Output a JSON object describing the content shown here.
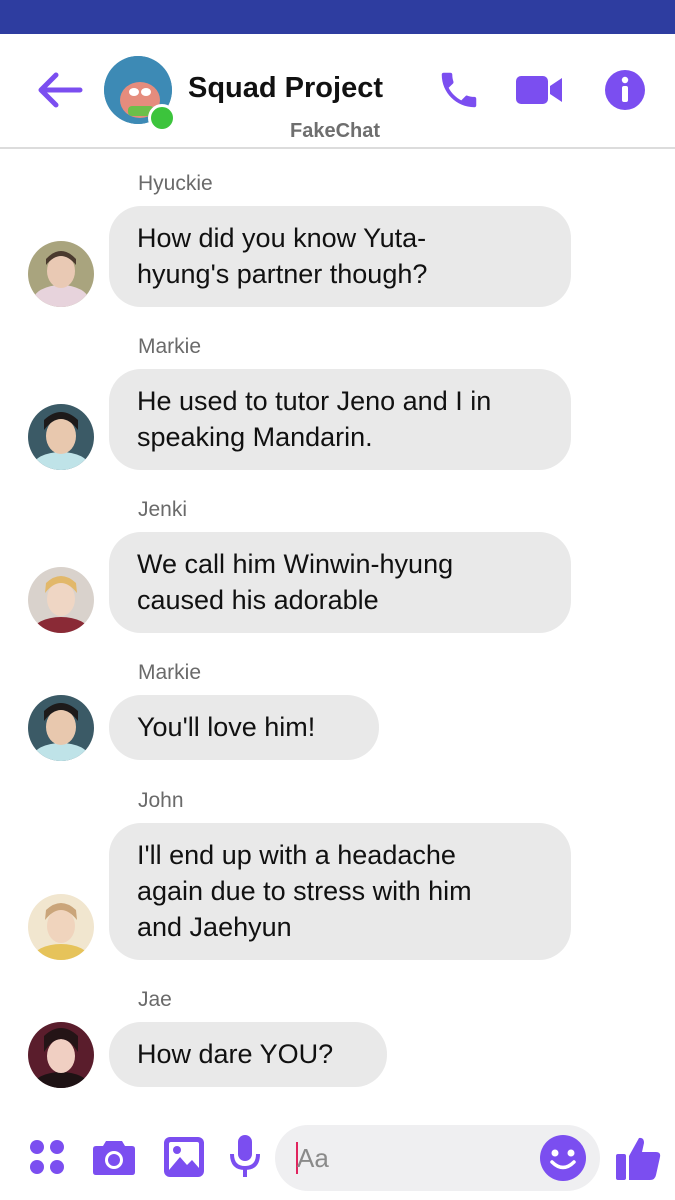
{
  "header": {
    "title": "Squad Project",
    "subtitle": "FakeChat",
    "accent_color": "#7b4ef0",
    "status_bar_color": "#2e3da0",
    "icons": [
      "back-arrow-icon",
      "phone-icon",
      "video-camera-icon",
      "info-icon"
    ]
  },
  "messages": [
    {
      "sender": "Hyuckie",
      "text": "How did you know Yuta-hyung's partner though?",
      "lines": [
        "How did you know Yuta-",
        "hyung's partner though?"
      ]
    },
    {
      "sender": "Markie",
      "text": "He used to tutor Jeno and I in speaking Mandarin.",
      "lines": [
        "He used to tutor Jeno and I in",
        "speaking Mandarin."
      ]
    },
    {
      "sender": "Jenki",
      "text": "We call him Winwin-hyung caused his adorable",
      "lines": [
        "We call him Winwin-hyung",
        "caused his adorable"
      ]
    },
    {
      "sender": "Markie",
      "text": "You'll love him!",
      "lines": [
        "You'll love him!"
      ]
    },
    {
      "sender": "John",
      "text": "I'll end up with a headache again due to stress with him and Jaehyun",
      "lines": [
        "I'll end up with a headache",
        "again due to stress with him",
        "and Jaehyun"
      ]
    },
    {
      "sender": "Jae",
      "text": "How dare YOU?",
      "lines": [
        "How dare YOU?"
      ]
    }
  ],
  "composer": {
    "placeholder": "Aa",
    "icons": [
      "apps-grid-icon",
      "camera-icon",
      "image-icon",
      "microphone-icon",
      "emoji-icon",
      "thumbs-up-icon"
    ]
  }
}
